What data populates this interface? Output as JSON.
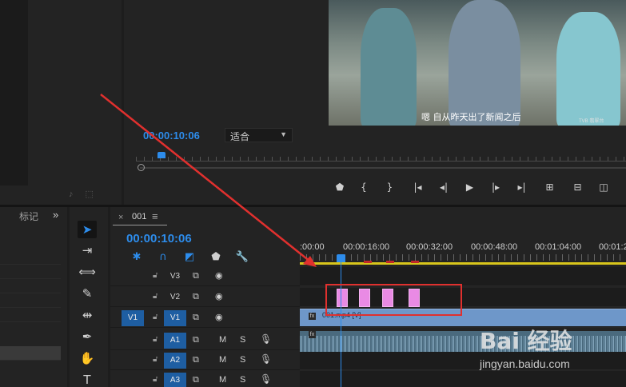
{
  "program": {
    "timecode": "00:00:10:06",
    "fit_select": "适合",
    "subtitle": "嗯 自从昨天出了新闻之后",
    "watermark_small": "TVB 翡翠台",
    "transport": [
      "marker",
      "in",
      "out",
      "go-in",
      "step-back",
      "play",
      "step-fwd",
      "go-out",
      "lift",
      "extract",
      "more"
    ]
  },
  "left_panel": {
    "tab_label": "标记",
    "chevron": "»"
  },
  "timeline": {
    "close": "×",
    "sequence_name": "001",
    "menu": "≡",
    "timecode": "00:00:10:06",
    "ruler": [
      ":00:00",
      "00:00:16:00",
      "00:00:32:00",
      "00:00:48:00",
      "00:01:04:00",
      "00:01:2"
    ],
    "tracks": [
      {
        "name": "V3",
        "kind": "video",
        "active": false
      },
      {
        "name": "V2",
        "kind": "video",
        "active": false
      },
      {
        "name": "V1",
        "kind": "video",
        "active": true,
        "source_patch": "V1"
      },
      {
        "name": "A1",
        "kind": "audio",
        "active": true,
        "mute": "M",
        "solo": "S"
      },
      {
        "name": "A2",
        "kind": "audio",
        "active": true,
        "mute": "M",
        "solo": "S"
      },
      {
        "name": "A3",
        "kind": "audio",
        "active": true,
        "mute": "M",
        "solo": "S"
      }
    ],
    "video_clip_label": "001.mp4 [V]",
    "fx_badge": "fx"
  },
  "watermark": {
    "main": "Bai 经验",
    "url": "jingyan.baidu.com"
  },
  "colors": {
    "accent_blue": "#2d8ceb",
    "clip_pink": "#e98ae4",
    "video_clip": "#6e97c9",
    "highlight": "#e0302e",
    "work_area": "#d8c51c"
  }
}
